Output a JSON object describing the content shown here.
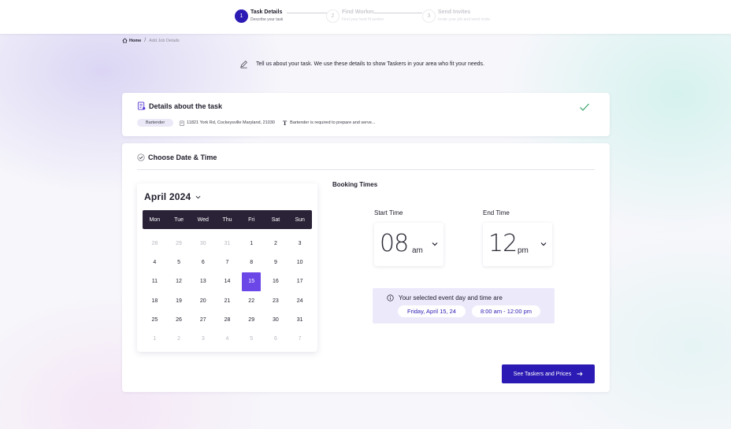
{
  "stepper": {
    "steps": [
      {
        "num": "1",
        "title": "Task Details",
        "sub": "Describe your task",
        "state": "active"
      },
      {
        "num": "2",
        "title": "Find Worker",
        "sub": "Find your best fit worker",
        "state": "inactive"
      },
      {
        "num": "3",
        "title": "Send Invites",
        "sub": "Invite your job and send invite",
        "state": "inactive"
      }
    ]
  },
  "breadcrumb": {
    "home": "Home",
    "separator": "/",
    "current": "Add Job Details"
  },
  "intro": {
    "text": "Tell us about your task. We use these details to show Taskers in your area who fit your needs."
  },
  "details": {
    "title": "Details about the task",
    "tag": "Bartender",
    "address": "11821 York Rd, Cockeysville Maryland, 21030",
    "text_icon": "T",
    "description": "Bartender is required to prepare and serve..."
  },
  "date_time": {
    "title": "Choose Date & Time",
    "calendar": {
      "month_label": "April 2024",
      "weekdays": [
        "Mon",
        "Tue",
        "Wed",
        "Thu",
        "Fri",
        "Sat",
        "Sun"
      ],
      "days": [
        {
          "d": "28",
          "m": true
        },
        {
          "d": "29",
          "m": true
        },
        {
          "d": "30",
          "m": true
        },
        {
          "d": "31",
          "m": true
        },
        {
          "d": "1"
        },
        {
          "d": "2"
        },
        {
          "d": "3"
        },
        {
          "d": "4"
        },
        {
          "d": "5"
        },
        {
          "d": "6"
        },
        {
          "d": "7"
        },
        {
          "d": "8"
        },
        {
          "d": "9"
        },
        {
          "d": "10"
        },
        {
          "d": "11"
        },
        {
          "d": "12"
        },
        {
          "d": "13"
        },
        {
          "d": "14"
        },
        {
          "d": "15",
          "sel": true
        },
        {
          "d": "16"
        },
        {
          "d": "17"
        },
        {
          "d": "18"
        },
        {
          "d": "19"
        },
        {
          "d": "20"
        },
        {
          "d": "21"
        },
        {
          "d": "22"
        },
        {
          "d": "23"
        },
        {
          "d": "24"
        },
        {
          "d": "25"
        },
        {
          "d": "26"
        },
        {
          "d": "27"
        },
        {
          "d": "28"
        },
        {
          "d": "29"
        },
        {
          "d": "30"
        },
        {
          "d": "31"
        },
        {
          "d": "1",
          "m": true
        },
        {
          "d": "2",
          "m": true
        },
        {
          "d": "3",
          "m": true
        },
        {
          "d": "4",
          "m": true
        },
        {
          "d": "5",
          "m": true
        },
        {
          "d": "6",
          "m": true
        },
        {
          "d": "7",
          "m": true
        }
      ]
    },
    "booking": {
      "title": "Booking Times",
      "start_label": "Start Time",
      "start_hour": "08",
      "start_ampm": "am",
      "end_label": "End Time",
      "end_hour": "12",
      "end_ampm": "pm"
    },
    "summary": {
      "message": "Your selected event day and time are",
      "date": "Friday, April 15, 24",
      "time": "8:00 am - 12:00 pm"
    },
    "cta_label": "See Taskers and Prices"
  },
  "colors": {
    "accent": "#2b1ab3",
    "selected_day": "#6c47e8",
    "week_header": "#2a2237",
    "check": "#3aa36b",
    "summary_bg": "#ece9fb"
  }
}
